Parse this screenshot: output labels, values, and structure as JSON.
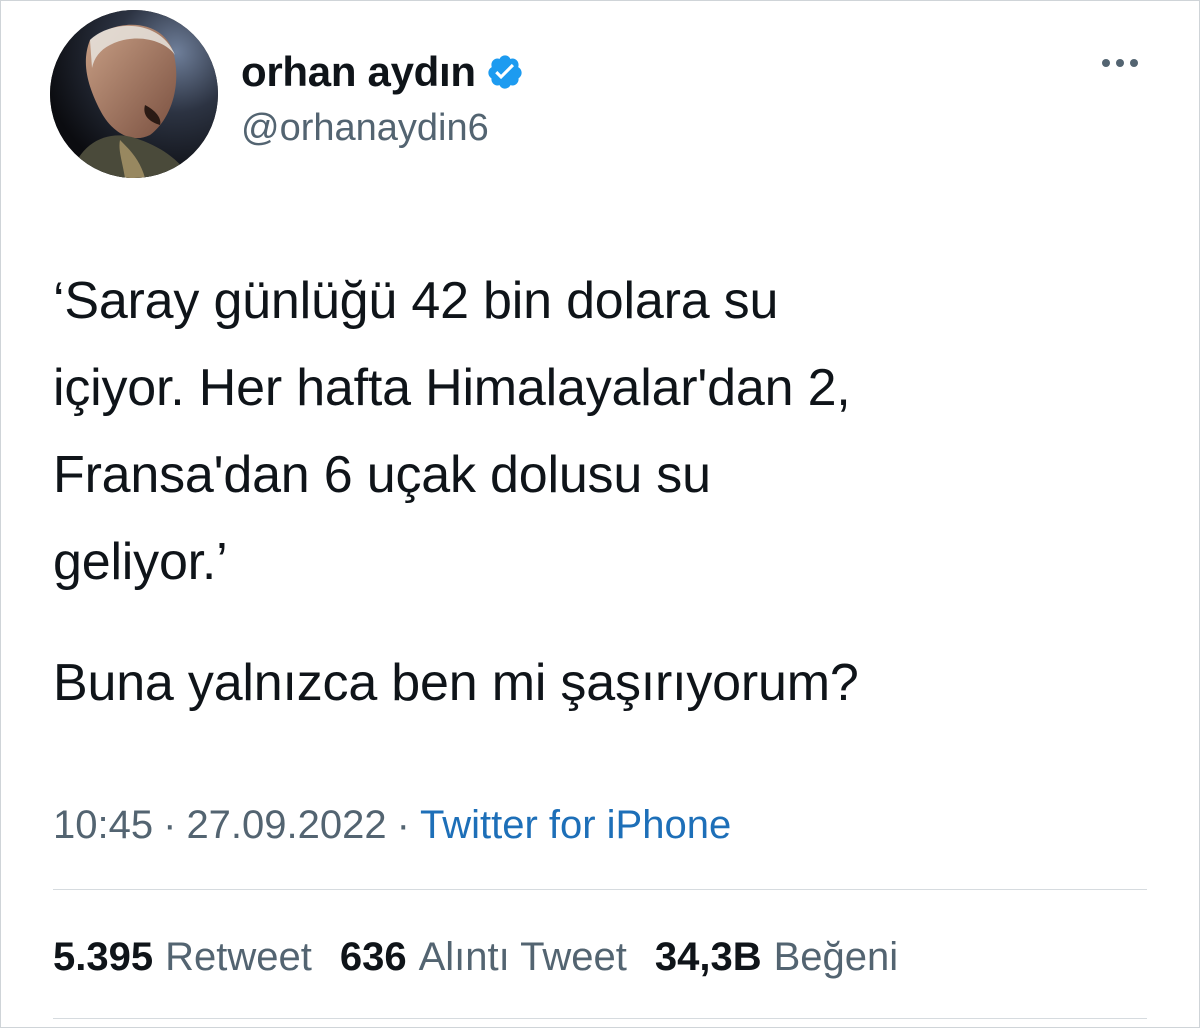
{
  "author": {
    "display_name": "orhan aydın",
    "handle": "@orhanaydin6",
    "verified": true
  },
  "tweet": {
    "body": "‘Saray günlüğü 42 bin dolara su\niçiyor. Her hafta Himalayalar'dan 2,\nFransa'dan 6 uçak dolusu su\ngeliyor.’",
    "body2": "Buna yalnızca ben mi şaşırıyorum?",
    "time": "10:45",
    "date": "27.09.2022",
    "separator": "·",
    "source": "Twitter for iPhone"
  },
  "stats": {
    "retweets": {
      "count": "5.395",
      "label": "Retweet"
    },
    "quotes": {
      "count": "636",
      "label": "Alıntı Tweet"
    },
    "likes": {
      "count": "34,3B",
      "label": "Beğeni"
    }
  },
  "icons": {
    "verified": "verified-badge-icon",
    "more": "more-horizontal-icon"
  },
  "colors": {
    "text": "#0f1419",
    "muted": "#536471",
    "link": "#1d6fb8",
    "verified": "#1d9bf0"
  }
}
